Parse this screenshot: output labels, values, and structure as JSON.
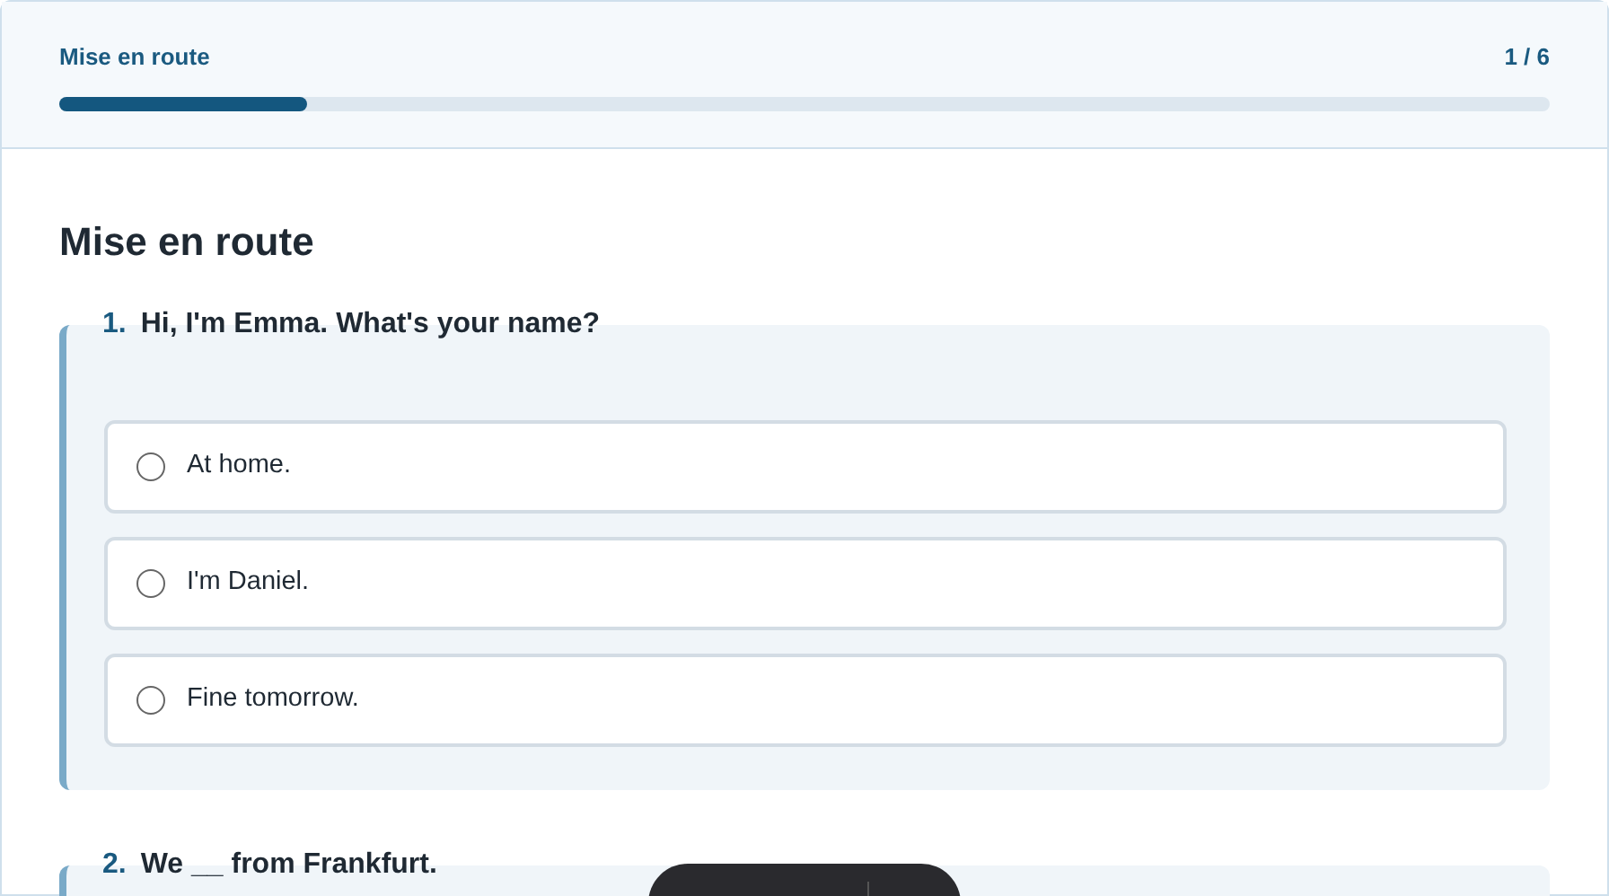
{
  "header": {
    "title": "Mise en route",
    "counter": "1 / 6",
    "progress": {
      "level": 0.166
    }
  },
  "section_title": "Mise en route",
  "questions": [
    {
      "number": "1.",
      "text": "Hi, I'm Emma. What's your name?",
      "options": [
        {
          "label": "At home.",
          "selected": false
        },
        {
          "label": "I'm Daniel.",
          "selected": false
        },
        {
          "label": "Fine tomorrow.",
          "selected": false
        }
      ]
    },
    {
      "number": "2.",
      "text": "We __ from Frankfurt."
    }
  ]
}
